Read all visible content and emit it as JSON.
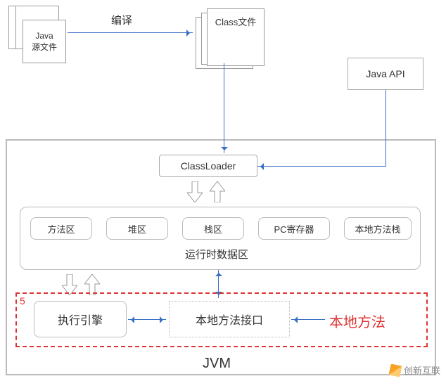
{
  "source_stack": {
    "line1": "Java",
    "line2": "源文件"
  },
  "compile_label": "编译",
  "class_stack": {
    "label": "Class文件"
  },
  "java_api": "Java API",
  "classloader": "ClassLoader",
  "runtime": {
    "method_area": "方法区",
    "heap": "堆区",
    "stack": "栈区",
    "pc": "PC寄存器",
    "native_stack": "本地方法栈",
    "title": "运行时数据区"
  },
  "section5_num": "5",
  "exec_engine": "执行引擎",
  "native_interface": "本地方法接口",
  "native_methods": "本地方法",
  "jvm_label": "JVM",
  "watermark": "创新互联"
}
